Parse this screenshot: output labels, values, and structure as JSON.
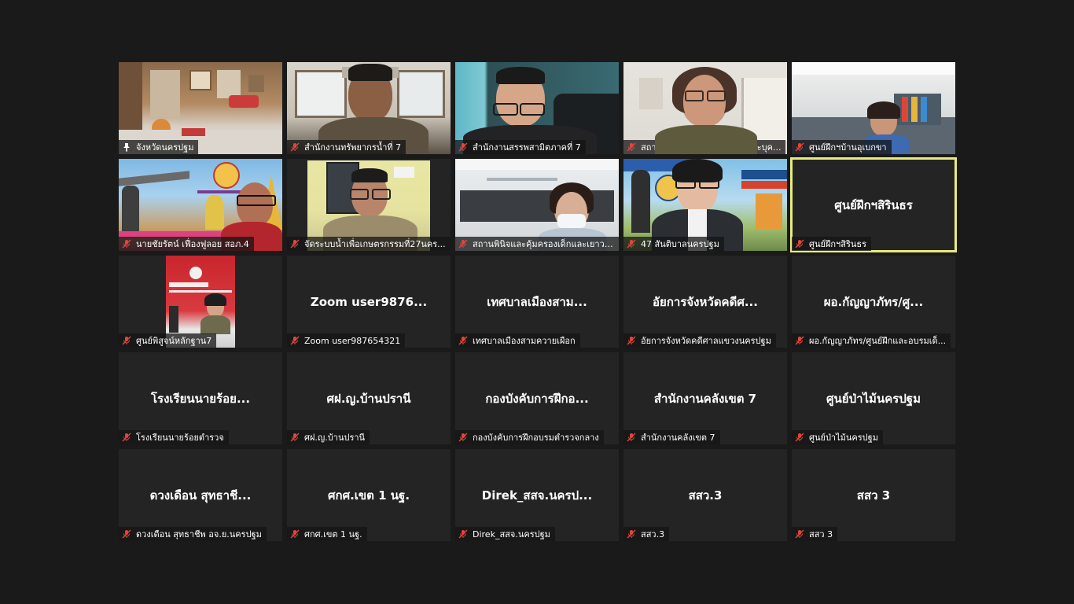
{
  "meeting": {
    "tiles": [
      {
        "label": "จังหวัดนครปฐม",
        "icon": "pin-icon",
        "video": true,
        "display": ""
      },
      {
        "label": "สำนักงานทรัพยากรน้ำที่ 7",
        "icon": "mic-off-icon",
        "video": true,
        "display": ""
      },
      {
        "label": "สำนักงานสรรพสามิตภาคที่ 7",
        "icon": "mic-off-icon",
        "video": true,
        "display": ""
      },
      {
        "label": "สถาบันพัฒนาครู คณาจารย์ และบุค...",
        "icon": "mic-off-icon",
        "video": true,
        "display": ""
      },
      {
        "label": "ศูนย์ฝึกฯบ้านอุเบกขา",
        "icon": "mic-off-icon",
        "video": true,
        "display": ""
      },
      {
        "label": "นายชัยรัตน์ เฟื่องฟูลอย สอภ.4",
        "icon": "mic-off-icon",
        "video": true,
        "display": ""
      },
      {
        "label": "จัดระบบน้ำเพื่อเกษตรกรรมที่27นคร...",
        "icon": "mic-off-icon",
        "video": true,
        "display": ""
      },
      {
        "label": "สถานพินิจและคุ้มครองเด็กและเยาวช...",
        "icon": "mic-off-icon",
        "video": true,
        "display": ""
      },
      {
        "label": "47 สันติบาลนครปฐม",
        "icon": "mic-off-icon",
        "video": true,
        "display": ""
      },
      {
        "label": "ศูนย์ฝึกฯสิรินธร",
        "icon": "mic-off-icon",
        "video": false,
        "display": "ศูนย์ฝึกฯสิรินธร",
        "active": true
      },
      {
        "label": "ศูนย์พิสูจน์หลักฐาน7",
        "icon": "mic-off-icon",
        "video": true,
        "display": ""
      },
      {
        "label": "Zoom user987654321",
        "icon": "mic-off-icon",
        "video": false,
        "display": "Zoom user9876..."
      },
      {
        "label": "เทศบาลเมืองสามควายเผือก",
        "icon": "mic-off-icon",
        "video": false,
        "display": "เทศบาลเมืองสาม..."
      },
      {
        "label": "อัยการจังหวัดคดีศาลแขวงนครปฐม",
        "icon": "mic-off-icon",
        "video": false,
        "display": "อัยการจังหวัดคดีศ..."
      },
      {
        "label": "ผอ.กัญญาภัทร/ศูนย์ฝึกและอบรมเด็...",
        "icon": "mic-off-icon",
        "video": false,
        "display": "ผอ.กัญญาภัทร/ศู..."
      },
      {
        "label": "โรงเรียนนายร้อยตำรวจ",
        "icon": "mic-off-icon",
        "video": false,
        "display": "โรงเรียนนายร้อย..."
      },
      {
        "label": "ศฝ.ญ.บ้านปรานี",
        "icon": "mic-off-icon",
        "video": false,
        "display": "ศฝ.ญ.บ้านปรานี"
      },
      {
        "label": "กองบังคับการฝึกอบรมตำรวจกลาง",
        "icon": "mic-off-icon",
        "video": false,
        "display": "กองบังคับการฝึกอ..."
      },
      {
        "label": "สำนักงานคลังเขต 7",
        "icon": "mic-off-icon",
        "video": false,
        "display": "สำนักงานคลังเขต 7"
      },
      {
        "label": "ศูนย์ป่าไม้นครปฐม",
        "icon": "mic-off-icon",
        "video": false,
        "display": "ศูนย์ป่าไม้นครปฐม"
      },
      {
        "label": "ดวงเดือน สุทธาชีพ อจ.ย.นครปฐม",
        "icon": "mic-off-icon",
        "video": false,
        "display": "ดวงเดือน สุทธาชี..."
      },
      {
        "label": "ศกศ.เขต 1 นฐ.",
        "icon": "mic-off-icon",
        "video": false,
        "display": "ศกศ.เขต 1 นฐ."
      },
      {
        "label": "Direk_สสจ.นครปฐม",
        "icon": "mic-off-icon",
        "video": false,
        "display": "Direk_สสจ.นครป..."
      },
      {
        "label": "สสว.3",
        "icon": "mic-off-icon",
        "video": false,
        "display": "สสว.3"
      },
      {
        "label": "สสว 3",
        "icon": "mic-off-icon",
        "video": false,
        "display": "สสว 3"
      }
    ]
  },
  "colors": {
    "background": "#1a1a1a",
    "tile": "#242424",
    "active_border": "#e8ec7a",
    "mic_off": "#e0463e"
  }
}
